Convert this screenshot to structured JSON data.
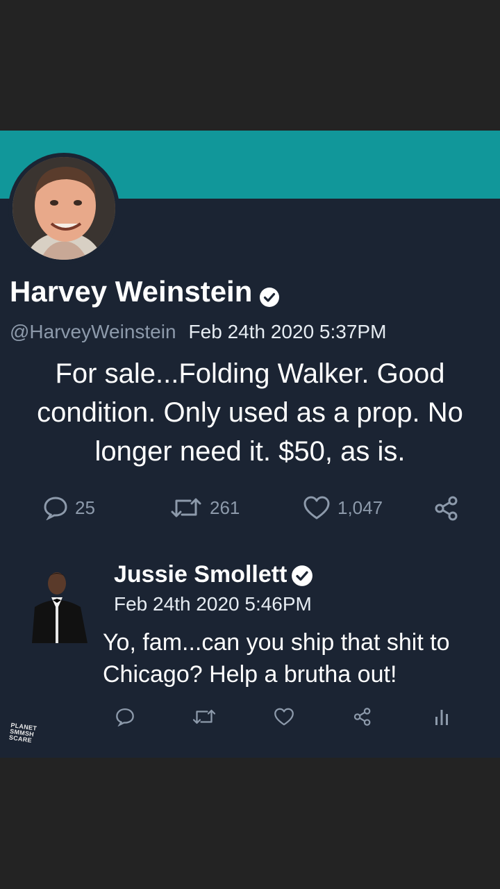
{
  "main_tweet": {
    "display_name": "Harvey Weinstein",
    "handle": "@HarveyWeinstein",
    "timestamp": "Feb 24th 2020 5:37PM",
    "text": "For sale...Folding Walker. Good condition. Only used as a prop. No longer need it. $50, as is.",
    "reply_count": "25",
    "retweet_count": "261",
    "like_count": "1,047"
  },
  "reply_tweet": {
    "display_name": "Jussie Smollett",
    "timestamp": "Feb 24th 2020 5:46PM",
    "text": "Yo, fam...can you ship that shit to Chicago? Help a brutha out!"
  },
  "watermark": "PLANET SMMSH SCARE",
  "icons": {
    "verified": "verified-badge-icon",
    "reply": "speech-bubble-icon",
    "retweet": "retweet-arrows-icon",
    "like": "heart-icon",
    "share": "share-nodes-icon",
    "analytics": "bar-chart-icon"
  },
  "colors": {
    "banner": "#11979a",
    "card_bg": "#1b2433",
    "outer_bg": "#232323",
    "muted_text": "#8d9aab"
  }
}
